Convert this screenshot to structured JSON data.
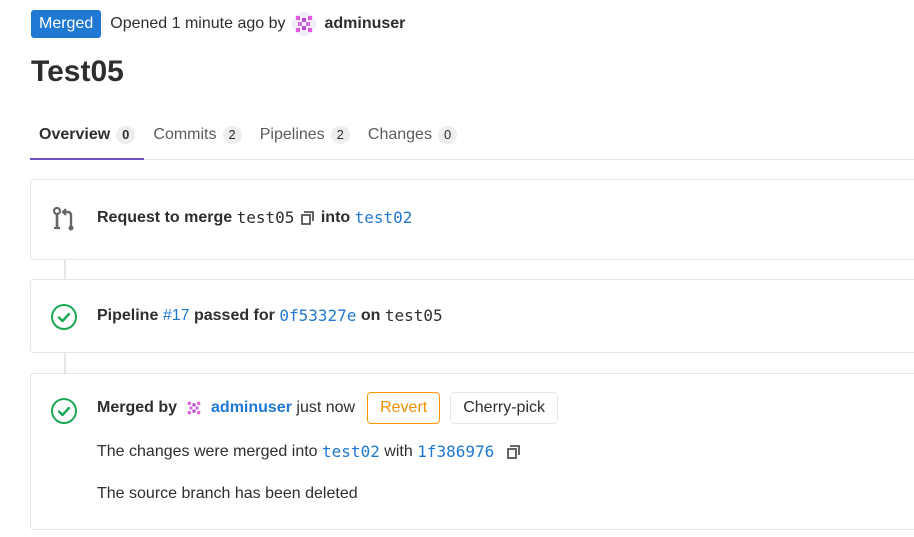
{
  "header": {
    "status_badge": "Merged",
    "opened_text": "Opened 1 minute ago by",
    "author": "adminuser"
  },
  "title": "Test05",
  "tabs": [
    {
      "label": "Overview",
      "count": "0"
    },
    {
      "label": "Commits",
      "count": "2"
    },
    {
      "label": "Pipelines",
      "count": "2"
    },
    {
      "label": "Changes",
      "count": "0"
    }
  ],
  "merge_request": {
    "prefix": "Request to merge",
    "source_branch": "test05",
    "into": "into",
    "target_branch": "test02"
  },
  "pipeline": {
    "label": "Pipeline",
    "id": "#17",
    "passed_for": "passed for",
    "commit": "0f53327e",
    "on": "on",
    "branch": "test05"
  },
  "merged": {
    "merged_by": "Merged by",
    "user": "adminuser",
    "time": "just now",
    "revert_label": "Revert",
    "cherry_pick_label": "Cherry-pick",
    "changes_prefix": "The changes were merged into",
    "target_branch": "test02",
    "with": "with",
    "merge_commit": "1f386976",
    "source_deleted": "The source branch has been deleted"
  },
  "colors": {
    "accent": "#1f78d1",
    "success": "#1aaa55",
    "warning": "#fc9403",
    "active_tab": "#6b4fbb"
  }
}
